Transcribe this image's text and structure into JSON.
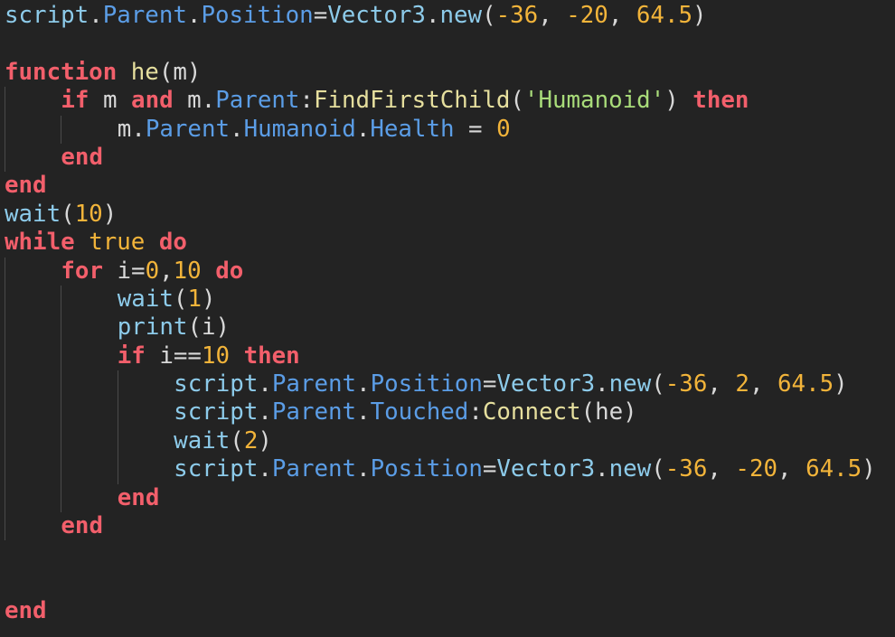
{
  "colors": {
    "background": "#232323",
    "keyword": "#f25f6b",
    "property": "#5b9de6",
    "global": "#8dcbea",
    "function": "#e6df9e",
    "number": "#f2b43a",
    "string": "#a9dc7a"
  },
  "lines": [
    {
      "indent": 0,
      "tokens": [
        [
          "g",
          "script"
        ],
        [
          "o",
          "."
        ],
        [
          "p",
          "Parent"
        ],
        [
          "o",
          "."
        ],
        [
          "p",
          "Position"
        ],
        [
          "o",
          "="
        ],
        [
          "g",
          "Vector3"
        ],
        [
          "o",
          "."
        ],
        [
          "g",
          "new"
        ],
        [
          "o",
          "("
        ],
        [
          "n",
          "-36"
        ],
        [
          "o",
          ", "
        ],
        [
          "n",
          "-20"
        ],
        [
          "o",
          ", "
        ],
        [
          "n",
          "64.5"
        ],
        [
          "o",
          ")"
        ]
      ]
    },
    {
      "indent": 0,
      "tokens": []
    },
    {
      "indent": 0,
      "tokens": [
        [
          "k",
          "function"
        ],
        [
          "o",
          " "
        ],
        [
          "f",
          "he"
        ],
        [
          "o",
          "("
        ],
        [
          "v",
          "m"
        ],
        [
          "o",
          ")"
        ]
      ]
    },
    {
      "indent": 1,
      "tokens": [
        [
          "k",
          "if"
        ],
        [
          "v",
          " m "
        ],
        [
          "k",
          "and"
        ],
        [
          "v",
          " m"
        ],
        [
          "o",
          "."
        ],
        [
          "p",
          "Parent"
        ],
        [
          "o",
          ":"
        ],
        [
          "f",
          "FindFirstChild"
        ],
        [
          "o",
          "("
        ],
        [
          "s",
          "'Humanoid'"
        ],
        [
          "o",
          ") "
        ],
        [
          "k",
          "then"
        ]
      ]
    },
    {
      "indent": 2,
      "tokens": [
        [
          "v",
          "m"
        ],
        [
          "o",
          "."
        ],
        [
          "p",
          "Parent"
        ],
        [
          "o",
          "."
        ],
        [
          "p",
          "Humanoid"
        ],
        [
          "o",
          "."
        ],
        [
          "p",
          "Health"
        ],
        [
          "o",
          " = "
        ],
        [
          "n",
          "0"
        ]
      ]
    },
    {
      "indent": 1,
      "tokens": [
        [
          "k",
          "end"
        ]
      ]
    },
    {
      "indent": 0,
      "tokens": [
        [
          "k",
          "end"
        ]
      ]
    },
    {
      "indent": 0,
      "tokens": [
        [
          "g",
          "wait"
        ],
        [
          "o",
          "("
        ],
        [
          "n",
          "10"
        ],
        [
          "o",
          ")"
        ]
      ]
    },
    {
      "indent": 0,
      "tokens": [
        [
          "k",
          "while"
        ],
        [
          "o",
          " "
        ],
        [
          "n",
          "true"
        ],
        [
          "o",
          " "
        ],
        [
          "k",
          "do"
        ]
      ]
    },
    {
      "indent": 1,
      "tokens": [
        [
          "k",
          "for"
        ],
        [
          "v",
          " i"
        ],
        [
          "o",
          "="
        ],
        [
          "n",
          "0"
        ],
        [
          "o",
          ","
        ],
        [
          "n",
          "10"
        ],
        [
          "o",
          " "
        ],
        [
          "k",
          "do"
        ]
      ]
    },
    {
      "indent": 2,
      "tokens": [
        [
          "g",
          "wait"
        ],
        [
          "o",
          "("
        ],
        [
          "n",
          "1"
        ],
        [
          "o",
          ")"
        ]
      ]
    },
    {
      "indent": 2,
      "tokens": [
        [
          "g",
          "print"
        ],
        [
          "o",
          "("
        ],
        [
          "v",
          "i"
        ],
        [
          "o",
          ")"
        ]
      ]
    },
    {
      "indent": 2,
      "tokens": [
        [
          "k",
          "if"
        ],
        [
          "v",
          " i"
        ],
        [
          "o",
          "=="
        ],
        [
          "n",
          "10"
        ],
        [
          "o",
          " "
        ],
        [
          "k",
          "then"
        ]
      ]
    },
    {
      "indent": 3,
      "tokens": [
        [
          "g",
          "script"
        ],
        [
          "o",
          "."
        ],
        [
          "p",
          "Parent"
        ],
        [
          "o",
          "."
        ],
        [
          "p",
          "Position"
        ],
        [
          "o",
          "="
        ],
        [
          "g",
          "Vector3"
        ],
        [
          "o",
          "."
        ],
        [
          "g",
          "new"
        ],
        [
          "o",
          "("
        ],
        [
          "n",
          "-36"
        ],
        [
          "o",
          ", "
        ],
        [
          "n",
          "2"
        ],
        [
          "o",
          ", "
        ],
        [
          "n",
          "64.5"
        ],
        [
          "o",
          ")"
        ]
      ]
    },
    {
      "indent": 3,
      "tokens": [
        [
          "g",
          "script"
        ],
        [
          "o",
          "."
        ],
        [
          "p",
          "Parent"
        ],
        [
          "o",
          "."
        ],
        [
          "p",
          "Touched"
        ],
        [
          "o",
          ":"
        ],
        [
          "f",
          "Connect"
        ],
        [
          "o",
          "("
        ],
        [
          "v",
          "he"
        ],
        [
          "o",
          ")"
        ]
      ]
    },
    {
      "indent": 3,
      "tokens": [
        [
          "g",
          "wait"
        ],
        [
          "o",
          "("
        ],
        [
          "n",
          "2"
        ],
        [
          "o",
          ")"
        ]
      ]
    },
    {
      "indent": 3,
      "tokens": [
        [
          "g",
          "script"
        ],
        [
          "o",
          "."
        ],
        [
          "p",
          "Parent"
        ],
        [
          "o",
          "."
        ],
        [
          "p",
          "Position"
        ],
        [
          "o",
          "="
        ],
        [
          "g",
          "Vector3"
        ],
        [
          "o",
          "."
        ],
        [
          "g",
          "new"
        ],
        [
          "o",
          "("
        ],
        [
          "n",
          "-36"
        ],
        [
          "o",
          ", "
        ],
        [
          "n",
          "-20"
        ],
        [
          "o",
          ", "
        ],
        [
          "n",
          "64.5"
        ],
        [
          "o",
          ")"
        ]
      ]
    },
    {
      "indent": 2,
      "tokens": [
        [
          "k",
          "end"
        ]
      ]
    },
    {
      "indent": 1,
      "tokens": [
        [
          "k",
          "end"
        ]
      ]
    },
    {
      "indent": 0,
      "tokens": []
    },
    {
      "indent": 0,
      "tokens": []
    },
    {
      "indent": 0,
      "tokens": [
        [
          "k",
          "end"
        ]
      ]
    }
  ]
}
